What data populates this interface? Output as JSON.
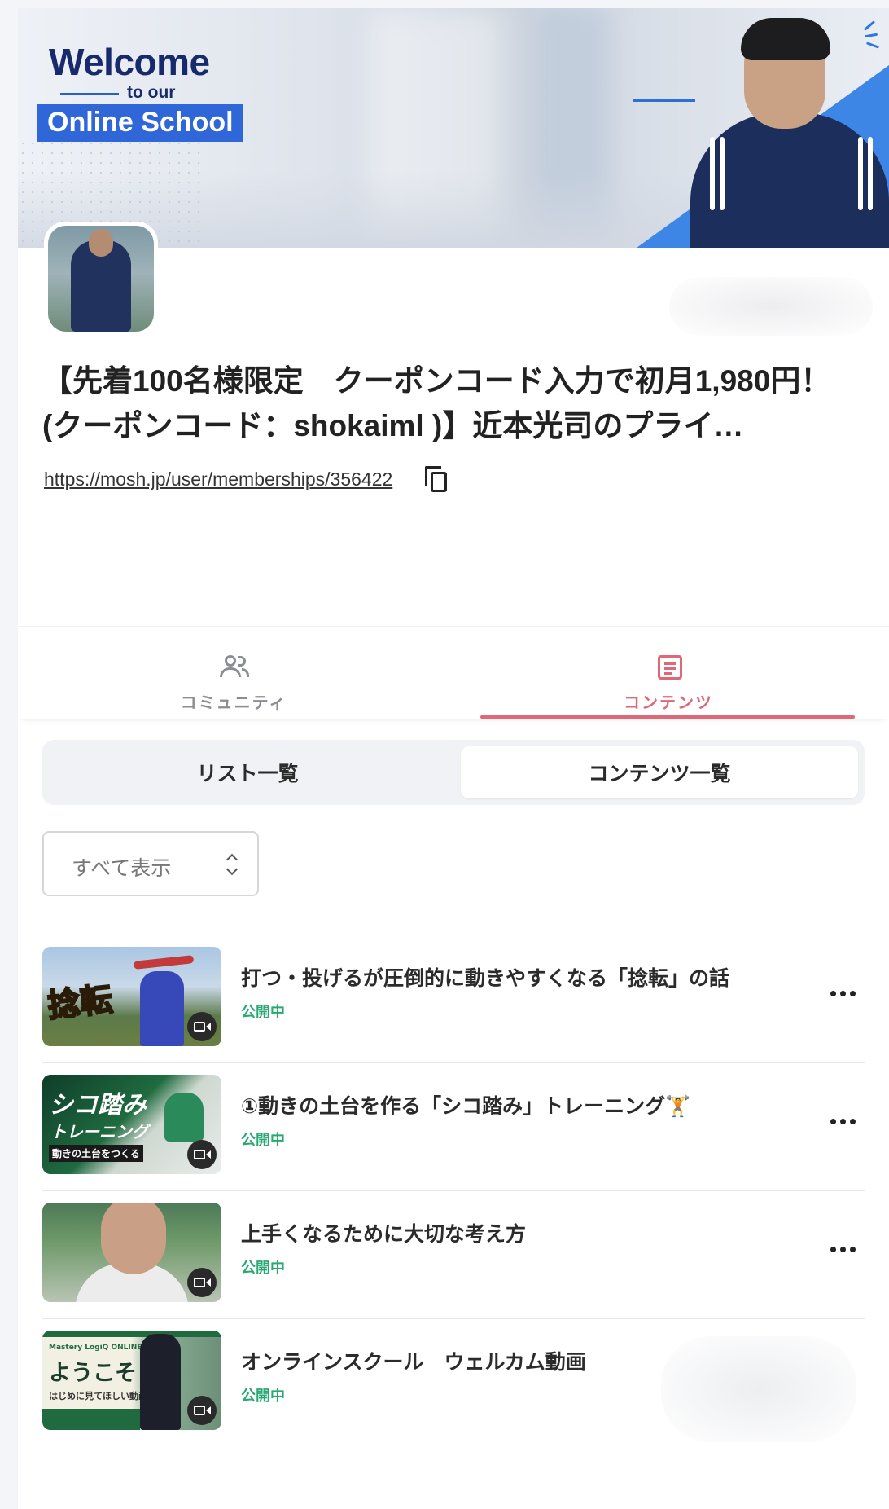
{
  "cover": {
    "welcome_line1": "Welcome",
    "welcome_line2": "to our",
    "welcome_line3": "Online School"
  },
  "header": {
    "title": "【先着100名様限定　クーポンコード入力で初月1,980円！(クーポンコード：shokaiml )】近本光司のプライ…",
    "url": "https://mosh.jp/user/memberships/356422"
  },
  "tabs": [
    {
      "label": "コミュニティ",
      "icon": "people-icon",
      "active": false
    },
    {
      "label": "コンテンツ",
      "icon": "document-icon",
      "active": true
    }
  ],
  "segmented": {
    "options": [
      "リスト一覧",
      "コンテンツ一覧"
    ],
    "selected": "コンテンツ一覧"
  },
  "filter": {
    "selected": "すべて表示"
  },
  "contents": [
    {
      "title": "打つ・投げるが圧倒的に動きやすくなる「捻転」の話",
      "status": "公開中",
      "thumb_text": "捻転"
    },
    {
      "title": "①動きの土台を作る「シコ踏み」トレーニング🏋️",
      "status": "公開中",
      "thumb_text": "シコ踏み",
      "thumb_text2": "トレーニング",
      "thumb_text3": "動きの土台をつくる"
    },
    {
      "title": "上手くなるために大切な考え方",
      "status": "公開中"
    },
    {
      "title": "オンラインスクール　ウェルカム動画",
      "status": "公開中",
      "thumb_brand": "Mastery LogiQ ONLINE",
      "thumb_text": "ようこそ",
      "thumb_text2": "はじめに見てほしい動画"
    }
  ],
  "colors": {
    "accent": "#e06775",
    "status_green": "#2aa873",
    "welcome_navy": "#172a6b",
    "welcome_blue": "#2f67d8"
  }
}
